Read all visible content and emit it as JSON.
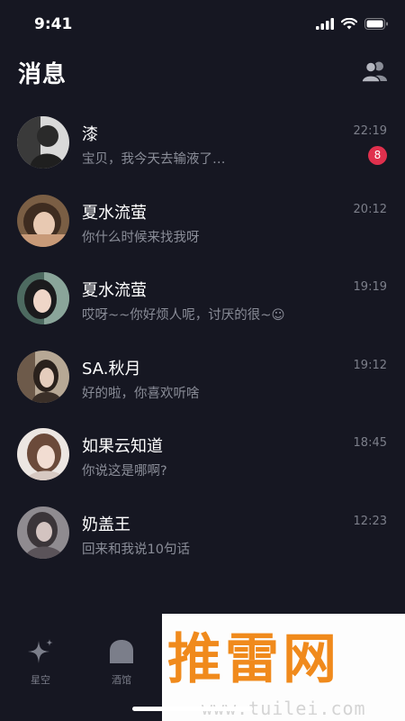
{
  "status_bar": {
    "time": "9:41"
  },
  "header": {
    "title": "消息",
    "contacts_icon": "people-icon"
  },
  "conversations": [
    {
      "name": "漆",
      "preview": "宝贝，我今天去输液了…",
      "time": "22:19",
      "unread": "8"
    },
    {
      "name": "夏水流萤",
      "preview": "你什么时候来找我呀",
      "time": "20:12"
    },
    {
      "name": "夏水流萤",
      "preview": "哎呀~~你好烦人呢，讨厌的很~☺",
      "time": "19:19"
    },
    {
      "name": "SA.秋月",
      "preview": "好的啦，你喜欢听啥",
      "time": "19:12"
    },
    {
      "name": "如果云知道",
      "preview": "你说这是哪啊?",
      "time": "18:45"
    },
    {
      "name": "奶盖王",
      "preview": "回来和我说10句话",
      "time": "12:23"
    }
  ],
  "tab_bar": {
    "tabs": [
      {
        "label": "星空",
        "icon": "sparkle-icon"
      },
      {
        "label": "酒馆",
        "icon": "tavern-icon"
      }
    ]
  },
  "watermark": {
    "main": "推雷网",
    "sub": "www.tuilei.com"
  },
  "colors": {
    "background": "#161722",
    "badge": "#e0304d",
    "muted_text": "#8a8d98",
    "watermark_orange": "#f08a1c"
  }
}
